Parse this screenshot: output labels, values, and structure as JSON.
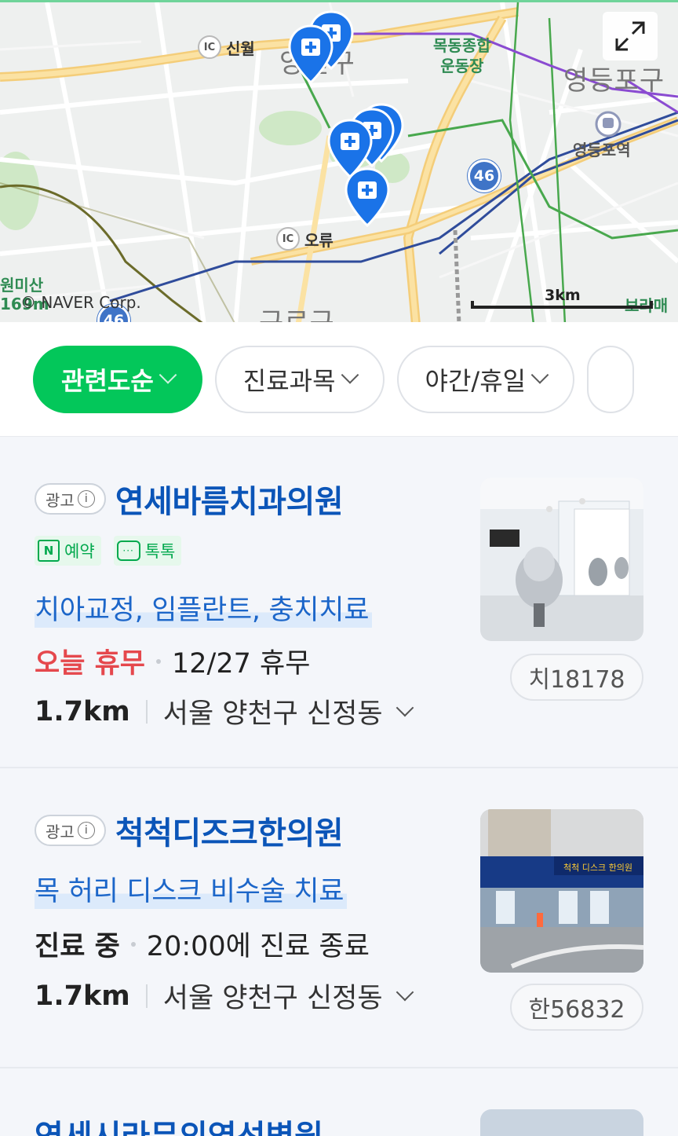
{
  "map": {
    "labels": {
      "ic_sinwol": "신월",
      "ic_oryu": "오류",
      "yangcheon_gu": "양천구",
      "mokdong_stadium": "목동종합\n운동장",
      "yeongdeungpo_gu": "영등포구",
      "yeongdeungpo_station": "영등포역",
      "guro_gu": "구로구",
      "wonmisan": "원미산\n169m",
      "borame": "보라매",
      "route_46": "46",
      "ic": "IC"
    },
    "copyright": "© NAVER Corp.",
    "scale": "3km"
  },
  "filters": [
    {
      "label": "관련도순",
      "active": true
    },
    {
      "label": "진료과목",
      "active": false
    },
    {
      "label": "야간/휴일",
      "active": false
    }
  ],
  "listings": [
    {
      "ad_label": "광고",
      "name": "연세바름치과의원",
      "reserve_label": "예약",
      "talk_label": "톡톡",
      "description": "치아교정, 임플란트, 충치치료",
      "status": "오늘 휴무",
      "status_detail": "12/27 휴무",
      "distance": "1.7km",
      "address": "서울 양천구 신정동",
      "code": "치18178"
    },
    {
      "ad_label": "광고",
      "name": "척척디즈크한의원",
      "description": "목 허리 디스크 비수술 치료",
      "status": "진료 중",
      "status_detail": "20:00에 진료 종료",
      "distance": "1.7km",
      "address": "서울 양천구 신정동",
      "code": "한56832",
      "sign_text": "척척 디스크 한의원"
    },
    {
      "name_partial": "연세시라무의영선병원"
    }
  ],
  "colors": {
    "accent_green": "#03c75a",
    "title_blue": "#0b55b8",
    "closed_red": "#e5484d",
    "pin_blue": "#1a73e8"
  }
}
